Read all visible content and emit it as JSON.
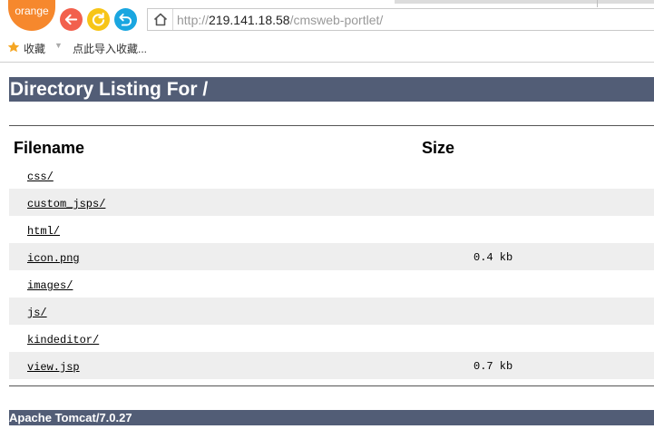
{
  "browser": {
    "logo_text": "orange",
    "address": {
      "protocol": "http://",
      "host": "219.141.18.58",
      "path": "/cmsweb-portlet/"
    },
    "bookmarks_bar": {
      "favorites_label": "收藏",
      "import_label": "点此导入收藏..."
    }
  },
  "page": {
    "title": "Directory Listing For /",
    "columns": {
      "filename": "Filename",
      "size": "Size"
    },
    "files": [
      {
        "name": "css/",
        "size": ""
      },
      {
        "name": "custom_jsps/",
        "size": ""
      },
      {
        "name": "html/",
        "size": ""
      },
      {
        "name": "icon.png",
        "size": "0.4 kb"
      },
      {
        "name": "images/",
        "size": ""
      },
      {
        "name": "js/",
        "size": ""
      },
      {
        "name": "kindeditor/",
        "size": ""
      },
      {
        "name": "view.jsp",
        "size": "0.7 kb"
      }
    ],
    "footer": "Apache Tomcat/7.0.27"
  },
  "colors": {
    "heading_bg": "#525d76",
    "row_alt_bg": "#eeeeee",
    "logo": "#f6882d",
    "back_button": "#f2604d",
    "refresh_button": "#f7c517",
    "undo_button": "#1aa6e0"
  }
}
